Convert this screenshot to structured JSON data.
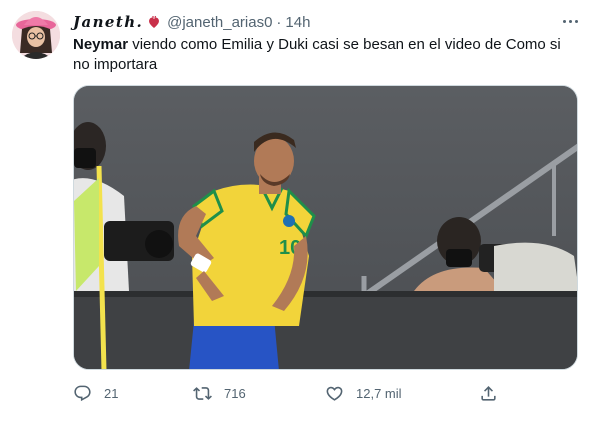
{
  "tweet": {
    "display_name": "Janeth.",
    "name_emoji": "anatomical-heart-emoji",
    "handle": "@janeth_arias0",
    "separator": "·",
    "time": "14h",
    "text_bold": "Neymar",
    "text_rest": " viendo como Emilia y Duki casi se besan en el video de Como si no importara",
    "media": {
      "description_icon": "photo",
      "jersey_number": "10"
    }
  },
  "actions": {
    "reply_icon": "reply-icon",
    "reply_count": "21",
    "retweet_icon": "retweet-icon",
    "retweet_count": "716",
    "like_icon": "heart-icon",
    "like_count": "12,7 mil",
    "share_icon": "share-icon"
  },
  "colors": {
    "text_primary": "#0f1419",
    "text_secondary": "#536471",
    "border": "#cfd9de",
    "jersey_yellow": "#f2d43a",
    "jersey_green": "#1f8f4a",
    "shorts_blue": "#2754c5"
  }
}
